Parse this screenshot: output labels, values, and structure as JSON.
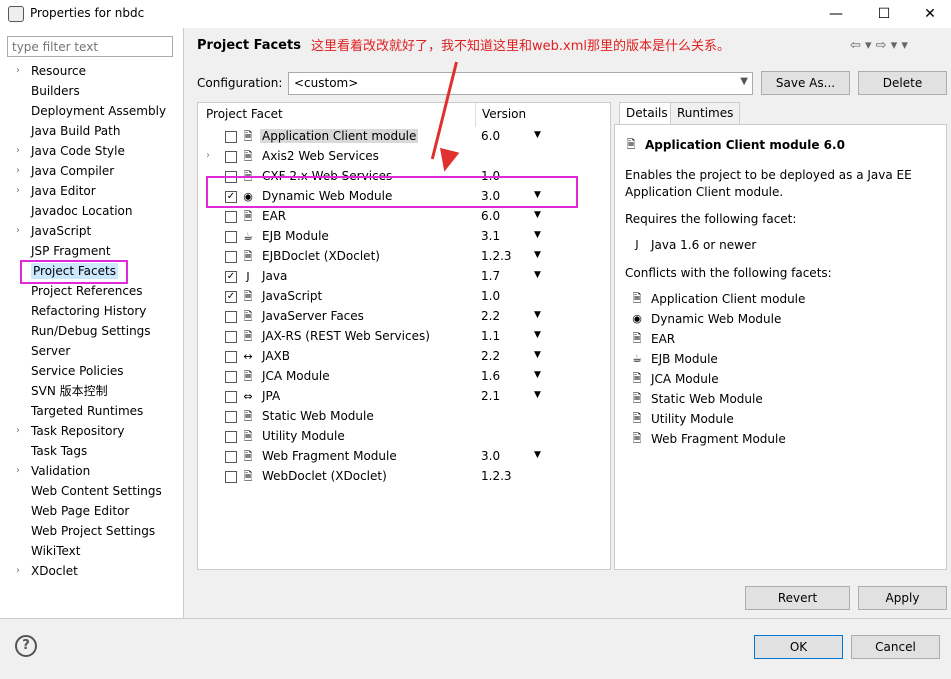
{
  "window": {
    "title": "Properties for nbdc",
    "minimize": "—",
    "maximize": "☐",
    "close": "✕"
  },
  "filter": {
    "placeholder": "type filter text"
  },
  "nav": [
    {
      "label": "Resource",
      "expandable": true
    },
    {
      "label": "Builders",
      "expandable": false
    },
    {
      "label": "Deployment Assembly",
      "expandable": false
    },
    {
      "label": "Java Build Path",
      "expandable": false
    },
    {
      "label": "Java Code Style",
      "expandable": true
    },
    {
      "label": "Java Compiler",
      "expandable": true
    },
    {
      "label": "Java Editor",
      "expandable": true
    },
    {
      "label": "Javadoc Location",
      "expandable": false
    },
    {
      "label": "JavaScript",
      "expandable": true
    },
    {
      "label": "JSP Fragment",
      "expandable": false
    },
    {
      "label": "Project Facets",
      "expandable": false,
      "selected": true
    },
    {
      "label": "Project References",
      "expandable": false
    },
    {
      "label": "Refactoring History",
      "expandable": false
    },
    {
      "label": "Run/Debug Settings",
      "expandable": false
    },
    {
      "label": "Server",
      "expandable": false
    },
    {
      "label": "Service Policies",
      "expandable": false
    },
    {
      "label": "SVN 版本控制",
      "expandable": false
    },
    {
      "label": "Targeted Runtimes",
      "expandable": false
    },
    {
      "label": "Task Repository",
      "expandable": true
    },
    {
      "label": "Task Tags",
      "expandable": false
    },
    {
      "label": "Validation",
      "expandable": true
    },
    {
      "label": "Web Content Settings",
      "expandable": false
    },
    {
      "label": "Web Page Editor",
      "expandable": false
    },
    {
      "label": "Web Project Settings",
      "expandable": false
    },
    {
      "label": "WikiText",
      "expandable": false
    },
    {
      "label": "XDoclet",
      "expandable": true
    }
  ],
  "header": {
    "title": "Project Facets",
    "annotation": "这里看着改改就好了，我不知道这里和web.xml那里的版本是什么关系。"
  },
  "config": {
    "label": "Configuration:",
    "value": "<custom>",
    "save_as": "Save As...",
    "delete": "Delete"
  },
  "facets_table": {
    "col_facet": "Project Facet",
    "col_version": "Version",
    "rows": [
      {
        "name": "Application Client module",
        "version": "6.0",
        "checked": false,
        "dropdown": true,
        "icon": "document-icon",
        "selected": true
      },
      {
        "name": "Axis2 Web Services",
        "version": "",
        "checked": false,
        "dropdown": false,
        "icon": "document-icon",
        "expandable": true
      },
      {
        "name": "CXF 2.x Web Services",
        "version": "1.0",
        "checked": false,
        "dropdown": false,
        "icon": "document-icon"
      },
      {
        "name": "Dynamic Web Module",
        "version": "3.0",
        "checked": true,
        "dropdown": true,
        "icon": "globe-icon"
      },
      {
        "name": "EAR",
        "version": "6.0",
        "checked": false,
        "dropdown": true,
        "icon": "document-icon"
      },
      {
        "name": "EJB Module",
        "version": "3.1",
        "checked": false,
        "dropdown": true,
        "icon": "bean-icon"
      },
      {
        "name": "EJBDoclet (XDoclet)",
        "version": "1.2.3",
        "checked": false,
        "dropdown": true,
        "icon": "document-icon"
      },
      {
        "name": "Java",
        "version": "1.7",
        "checked": true,
        "dropdown": true,
        "icon": "java-icon"
      },
      {
        "name": "JavaScript",
        "version": "1.0",
        "checked": true,
        "dropdown": false,
        "icon": "document-icon"
      },
      {
        "name": "JavaServer Faces",
        "version": "2.2",
        "checked": false,
        "dropdown": true,
        "icon": "document-icon"
      },
      {
        "name": "JAX-RS (REST Web Services)",
        "version": "1.1",
        "checked": false,
        "dropdown": true,
        "icon": "document-icon"
      },
      {
        "name": "JAXB",
        "version": "2.2",
        "checked": false,
        "dropdown": true,
        "icon": "jaxb-icon"
      },
      {
        "name": "JCA Module",
        "version": "1.6",
        "checked": false,
        "dropdown": true,
        "icon": "document-icon"
      },
      {
        "name": "JPA",
        "version": "2.1",
        "checked": false,
        "dropdown": true,
        "icon": "jpa-icon"
      },
      {
        "name": "Static Web Module",
        "version": "",
        "checked": false,
        "dropdown": false,
        "icon": "document-icon"
      },
      {
        "name": "Utility Module",
        "version": "",
        "checked": false,
        "dropdown": false,
        "icon": "document-icon"
      },
      {
        "name": "Web Fragment Module",
        "version": "3.0",
        "checked": false,
        "dropdown": true,
        "icon": "document-icon"
      },
      {
        "name": "WebDoclet (XDoclet)",
        "version": "1.2.3",
        "checked": false,
        "dropdown": false,
        "icon": "document-icon"
      }
    ]
  },
  "details": {
    "tab_details": "Details",
    "tab_runtimes": "Runtimes",
    "title": "Application Client module 6.0",
    "description_1": "Enables the project to be deployed as a Java EE",
    "description_2": "Application Client module.",
    "requires_label": "Requires the following facet:",
    "requires": [
      {
        "name": "Java 1.6 or newer",
        "icon": "java-icon"
      }
    ],
    "conflicts_label": "Conflicts with the following facets:",
    "conflicts": [
      {
        "name": "Application Client module",
        "icon": "document-icon"
      },
      {
        "name": "Dynamic Web Module",
        "icon": "globe-icon"
      },
      {
        "name": "EAR",
        "icon": "document-icon"
      },
      {
        "name": "EJB Module",
        "icon": "bean-icon"
      },
      {
        "name": "JCA Module",
        "icon": "document-icon"
      },
      {
        "name": "Static Web Module",
        "icon": "document-icon"
      },
      {
        "name": "Utility Module",
        "icon": "document-icon"
      },
      {
        "name": "Web Fragment Module",
        "icon": "document-icon"
      }
    ]
  },
  "buttons": {
    "revert": "Revert",
    "apply": "Apply",
    "ok": "OK",
    "cancel": "Cancel"
  },
  "colors": {
    "highlight_box": "#e02ad8",
    "annotation": "#e02020",
    "selection": "#cce8ff"
  }
}
